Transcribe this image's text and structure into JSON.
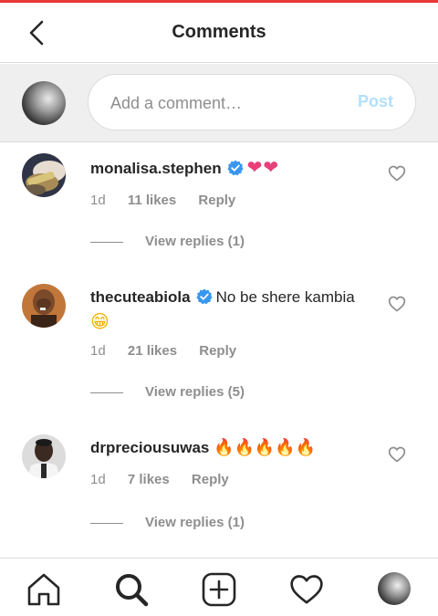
{
  "header": {
    "title": "Comments"
  },
  "composer": {
    "placeholder": "Add a comment…",
    "post_label": "Post"
  },
  "comments": [
    {
      "username": "monalisa.stephen",
      "verified": true,
      "text": "",
      "emoji": "❤❤",
      "time": "1d",
      "likes": "11 likes",
      "reply": "Reply",
      "view_replies": "View replies (1)"
    },
    {
      "username": "thecuteabiola",
      "verified": true,
      "text": "No be shere kambia",
      "emoji": "😁",
      "time": "1d",
      "likes": "21 likes",
      "reply": "Reply",
      "view_replies": "View replies (5)"
    },
    {
      "username": "drpreciousuwas",
      "verified": false,
      "text": "",
      "emoji": "🔥🔥🔥🔥🔥",
      "time": "1d",
      "likes": "7 likes",
      "reply": "Reply",
      "view_replies": "View replies (1)"
    }
  ],
  "colors": {
    "accent_red": "#e53935",
    "verified_blue": "#3897f0",
    "post_disabled": "#b2dffc",
    "muted": "#8e8e8e"
  },
  "icons": {
    "back": "chevron-left-icon",
    "like": "heart-outline-icon",
    "nav": [
      "home-icon",
      "search-icon",
      "add-post-icon",
      "activity-heart-icon",
      "profile-avatar"
    ]
  }
}
